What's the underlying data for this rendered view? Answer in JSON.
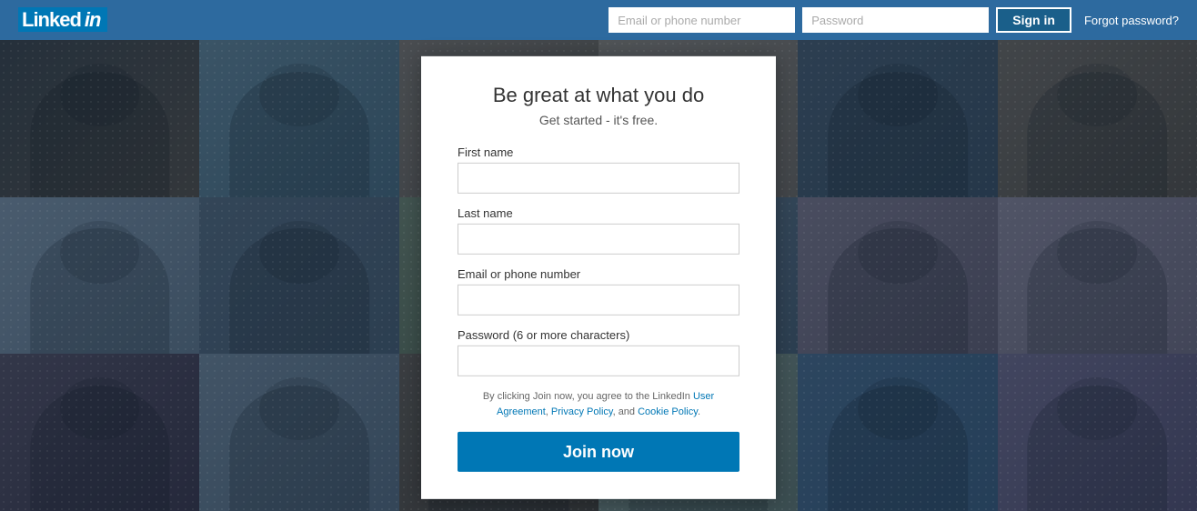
{
  "header": {
    "logo_text": "Linked",
    "logo_in": "in",
    "email_placeholder": "Email or phone number",
    "password_placeholder": "Password",
    "sign_in_label": "Sign in",
    "forgot_password_label": "Forgot password?"
  },
  "modal": {
    "title": "Be great at what you do",
    "subtitle": "Get started - it's free.",
    "fields": {
      "first_name_label": "First name",
      "last_name_label": "Last name",
      "email_label": "Email or phone number",
      "password_label": "Password (6 or more characters)"
    },
    "terms_text": "By clicking Join now, you agree to the LinkedIn User Agreement, Privacy Policy, and Cookie Policy.",
    "join_button_label": "Join now"
  },
  "colors": {
    "header_bg": "#2d6a9f",
    "join_btn": "#0077b5",
    "link_color": "#0077b5"
  }
}
